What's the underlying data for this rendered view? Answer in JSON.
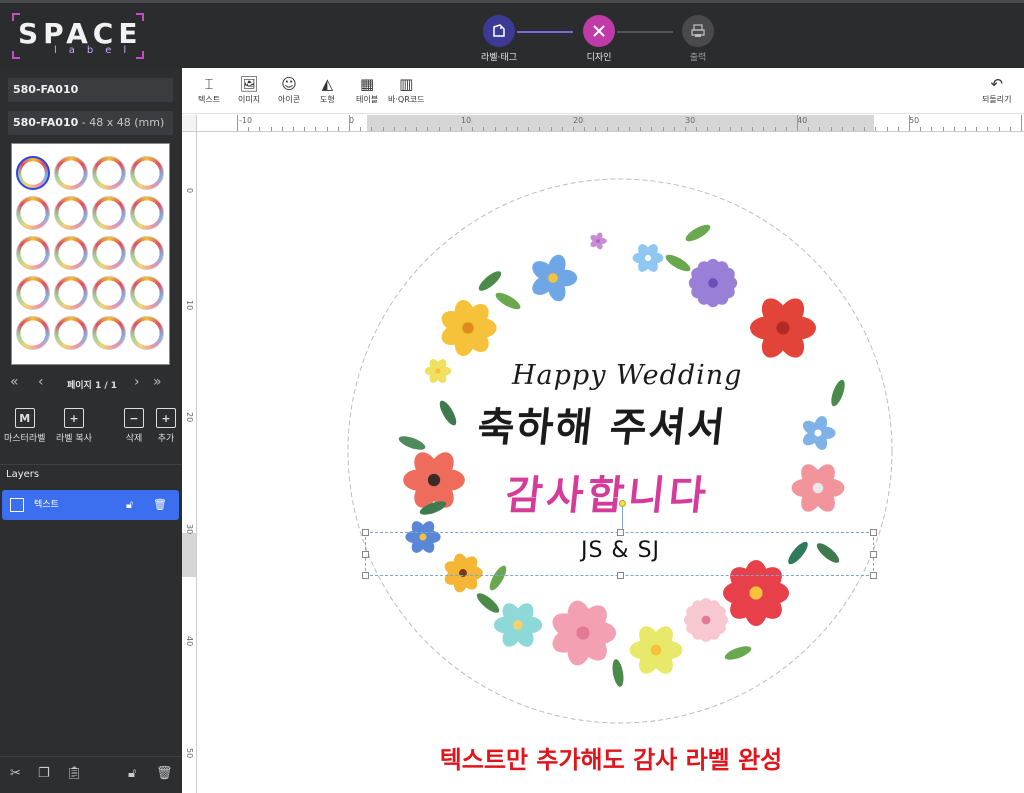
{
  "header": {
    "logo_text": "SPACE",
    "logo_sub": "label",
    "steps": [
      {
        "label": "라벨·태그"
      },
      {
        "label": "디자인"
      },
      {
        "label": "출력"
      }
    ]
  },
  "sidebar": {
    "product_code": "580-FA010",
    "product_name": "580-FA010",
    "product_size": " - 48 x 48 (mm)",
    "pager": {
      "label": "페이지 1 / 1"
    },
    "tools": [
      {
        "label": "마스터라벨"
      },
      {
        "label": "라벨 복사"
      },
      {
        "label": "삭제"
      },
      {
        "label": "추가"
      }
    ],
    "layers_title": "Layers",
    "layers": [
      {
        "label": "텍스트"
      }
    ]
  },
  "toolbar": {
    "items": [
      {
        "label": "텍스트",
        "icon": "text-tool-icon"
      },
      {
        "label": "이미지",
        "icon": "image-icon"
      },
      {
        "label": "아이콘",
        "icon": "emoji-icon"
      },
      {
        "label": "도형",
        "icon": "shape-icon"
      },
      {
        "label": "테이블",
        "icon": "table-icon"
      },
      {
        "label": "바·QR코드",
        "icon": "barcode-icon"
      }
    ],
    "undo_label": "되돌리기"
  },
  "rulers": {
    "top_labels": [
      "-10",
      "0",
      "10",
      "20",
      "30",
      "40",
      "50"
    ],
    "left_labels": [
      "0",
      "10",
      "20",
      "30",
      "40",
      "50"
    ]
  },
  "design": {
    "line1": "Happy Wedding",
    "line2": "축하해 주셔서",
    "line3": "감사합니다",
    "initials": "JS & SJ"
  },
  "caption": "텍스트만 추가해도 감사 라벨 완성",
  "colors": {
    "accent_blue": "#3b6ff0",
    "step_active": "#c03aa8",
    "highlight_pink": "#d63a9a",
    "caption_red": "#e0141b"
  }
}
